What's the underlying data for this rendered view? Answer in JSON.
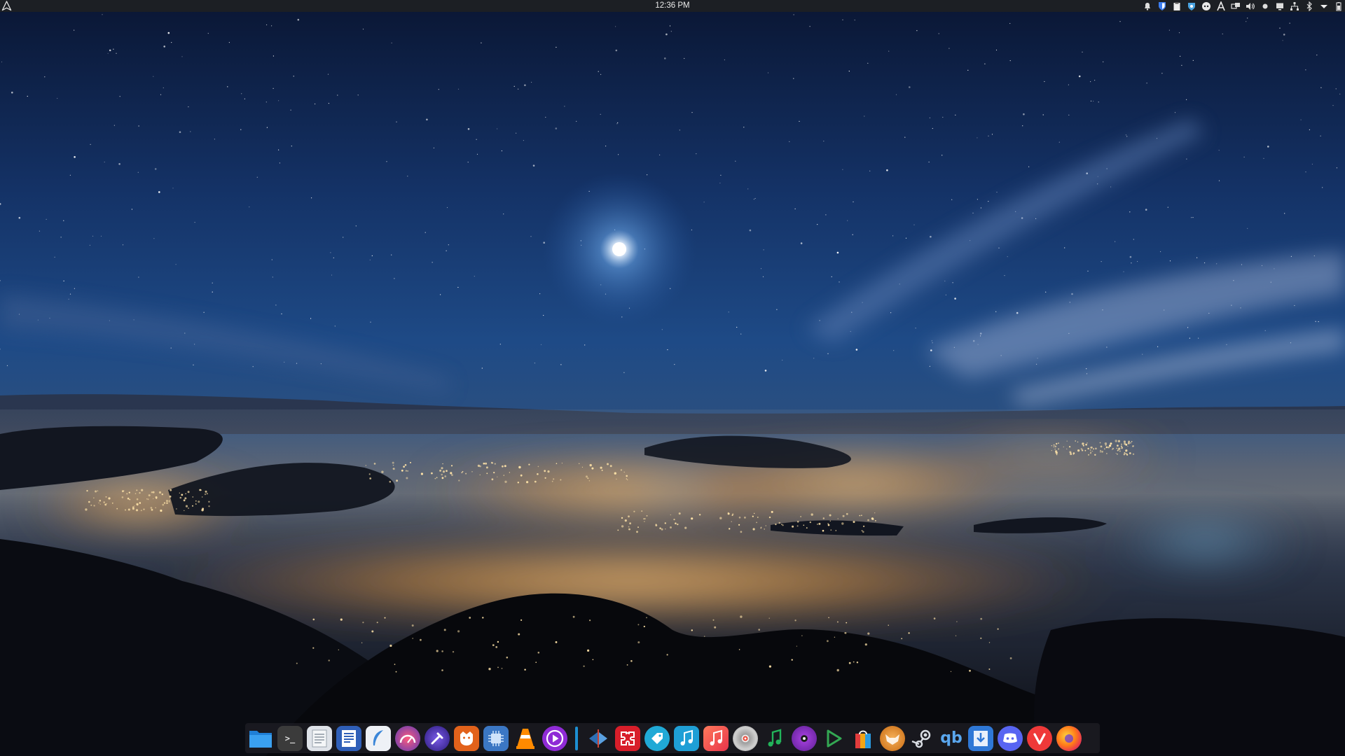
{
  "panel": {
    "clock": "12:36 PM",
    "launcher_icon": "arch-launcher-icon",
    "tray_icons": [
      "notification-bell-icon",
      "bitwarden-shield-icon",
      "clipboard-icon",
      "vpn-shield-icon",
      "discord-tray-icon",
      "font-a-icon",
      "network-icon",
      "volume-icon",
      "dot-icon",
      "display-icon",
      "network-tree-icon",
      "bluetooth-icon",
      "chevron-down-icon",
      "battery-icon"
    ]
  },
  "dock": {
    "apps": [
      {
        "name": "files",
        "icon": "folder-icon",
        "color": "#2a8fe6"
      },
      {
        "name": "terminal",
        "icon": "terminal-icon",
        "color": "#3a3a3a"
      },
      {
        "name": "text-editor",
        "icon": "notepad-icon",
        "color": "#d8dde5"
      },
      {
        "name": "document-writer",
        "icon": "document-icon",
        "color": "#2f5fb8"
      },
      {
        "name": "feather-notes",
        "icon": "feather-icon",
        "color": "#e9ecf2"
      },
      {
        "name": "system-monitor",
        "icon": "gauge-icon",
        "color": "#c43a6a"
      },
      {
        "name": "color-picker",
        "icon": "pipette-icon",
        "color": "#4b3ab5"
      },
      {
        "name": "gitkraken",
        "icon": "beard-icon",
        "color": "#e0601b"
      },
      {
        "name": "hardware-manager",
        "icon": "chip-icon",
        "color": "#3d7ac8"
      },
      {
        "name": "vlc",
        "icon": "traffic-cone-icon",
        "color": "#ff8a00"
      },
      {
        "name": "media-player",
        "icon": "play-circle-icon",
        "color": "#8f2bd6"
      },
      {
        "name": "separator",
        "icon": "separator-icon",
        "color": "#1d8fd2"
      },
      {
        "name": "kdenlive",
        "icon": "editor-arrow-icon",
        "color": "#2d6fb5"
      },
      {
        "name": "jigsaw",
        "icon": "puzzle-icon",
        "color": "#d81e2a"
      },
      {
        "name": "tagger",
        "icon": "tag-icon",
        "color": "#20a9d6"
      },
      {
        "name": "music-organizer",
        "icon": "music-note-icon",
        "color": "#1f9fd6"
      },
      {
        "name": "music-app",
        "icon": "music-square-icon",
        "color": "#f04c4c"
      },
      {
        "name": "disc-burner",
        "icon": "disc-icon",
        "color": "#b7b7b7"
      },
      {
        "name": "spotify-player",
        "icon": "music-green-icon",
        "color": "#1aa54a"
      },
      {
        "name": "audio-player",
        "icon": "vinyl-icon",
        "color": "#9b3bd4"
      },
      {
        "name": "stream-player",
        "icon": "play-triangle-icon",
        "color": "#33a853"
      },
      {
        "name": "app-store",
        "icon": "shopping-bag-icon",
        "color": "#f2a515"
      },
      {
        "name": "image-viewer",
        "icon": "fox-face-icon",
        "color": "#e78a1c"
      },
      {
        "name": "steam",
        "icon": "steam-icon",
        "color": "#1b2838"
      },
      {
        "name": "qbittorrent",
        "icon": "qb-icon",
        "color": "#3c87d6"
      },
      {
        "name": "downloader",
        "icon": "download-icon",
        "color": "#2f78d6"
      },
      {
        "name": "discord",
        "icon": "discord-icon",
        "color": "#5865f2"
      },
      {
        "name": "vivaldi",
        "icon": "vivaldi-icon",
        "color": "#ef3939"
      },
      {
        "name": "firefox",
        "icon": "firefox-icon",
        "color": "#ff6b1a"
      }
    ]
  },
  "colors": {
    "panel_bg": "#1c1f24",
    "sky_top": "#0b1b3d",
    "sky_mid": "#1d4680",
    "glow": "#f0a43a"
  }
}
